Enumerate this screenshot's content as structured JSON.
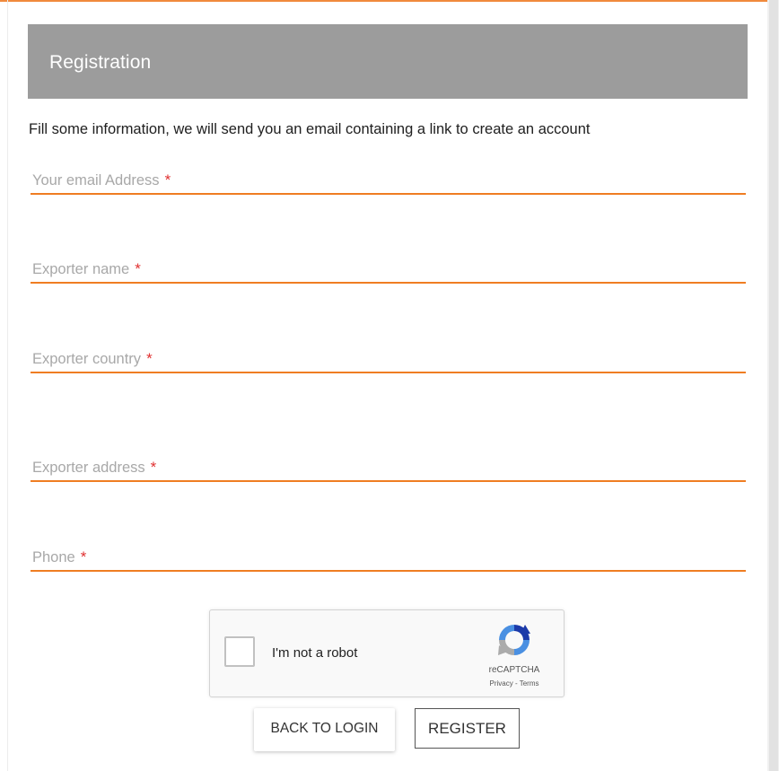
{
  "header": {
    "title": "Registration"
  },
  "intro": "Fill some information, we will send you an email containing a link to create an account",
  "fields": [
    {
      "label": "Your email Address",
      "required_mark": "*"
    },
    {
      "label": "Exporter name",
      "required_mark": "*"
    },
    {
      "label": "Exporter country",
      "required_mark": "*"
    },
    {
      "label": "Exporter address",
      "required_mark": "*"
    },
    {
      "label": "Phone",
      "required_mark": "*"
    }
  ],
  "captcha": {
    "label": "I'm not a robot",
    "brand": "reCAPTCHA",
    "links": "Privacy - Terms",
    "checked": false
  },
  "buttons": {
    "back": "BACK TO LOGIN",
    "register": "REGISTER"
  },
  "colors": {
    "accent": "#ef7d22",
    "header_bg": "#9c9c9c",
    "required": "#e03030"
  }
}
